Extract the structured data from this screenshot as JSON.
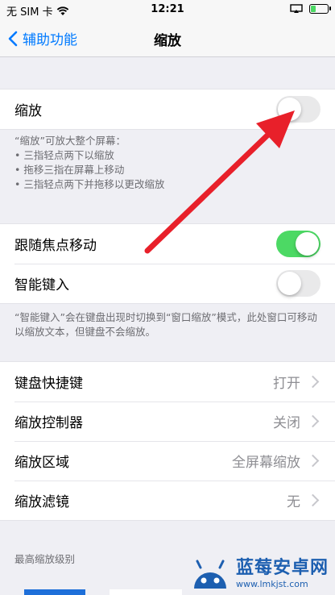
{
  "status_bar": {
    "carrier": "无 SIM 卡",
    "time": "12:21",
    "battery_level": 0.35
  },
  "nav": {
    "back_label": "辅助功能",
    "title": "缩放"
  },
  "zoom_group": {
    "label": "缩放",
    "enabled": false
  },
  "zoom_note": {
    "intro": "“缩放”可放大整个屏幕：",
    "bullets": [
      "三指轻点两下以缩放",
      "拖移三指在屏幕上移动",
      "三指轻点两下并拖移以更改缩放"
    ]
  },
  "focus_group": {
    "follow_focus": {
      "label": "跟随焦点移动",
      "enabled": true
    },
    "smart_typing": {
      "label": "智能键入",
      "enabled": false
    }
  },
  "smart_note": "“智能键入”会在键盘出现时切换到“窗口缩放”模式，此处窗口可移动以缩放文本，但键盘不会缩放。",
  "settings_group": [
    {
      "label": "键盘快捷键",
      "value": "打开"
    },
    {
      "label": "缩放控制器",
      "value": "关闭"
    },
    {
      "label": "缩放区域",
      "value": "全屏幕缩放"
    },
    {
      "label": "缩放滤镜",
      "value": "无"
    }
  ],
  "max_zoom_header": "最高缩放级别",
  "watermark": {
    "title": "蓝莓安卓网",
    "url": "www.lmkjst.com"
  },
  "colors": {
    "accent": "#007aff",
    "toggle_on": "#4cd964",
    "arrow": "#e8202a"
  }
}
